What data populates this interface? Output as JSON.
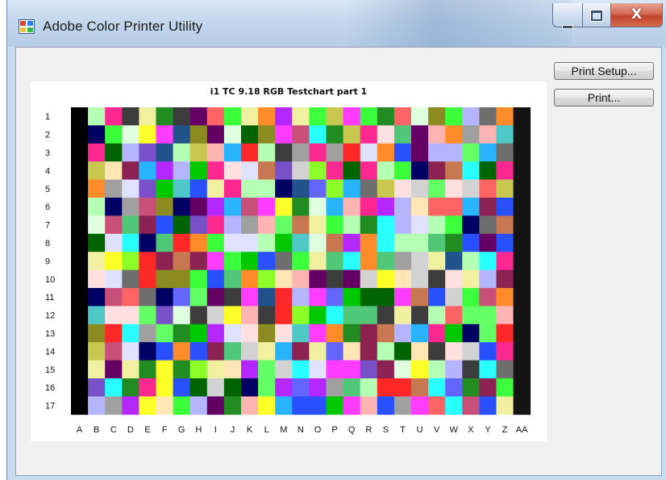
{
  "window": {
    "title": "Adobe Color Printer Utility",
    "controls": {
      "minimize": "minimize",
      "maximize": "maximize",
      "close": "X"
    }
  },
  "buttons": {
    "print_setup_label": "Print Setup...",
    "print_label": "Print..."
  },
  "chart_data": {
    "type": "heatmap",
    "title": "i1 TC 9.18 RGB Testchart part 1",
    "rows": [
      "1",
      "2",
      "3",
      "4",
      "5",
      "6",
      "7",
      "8",
      "9",
      "10",
      "11",
      "12",
      "13",
      "14",
      "15",
      "16",
      "17"
    ],
    "columns": [
      "A",
      "B",
      "C",
      "D",
      "E",
      "F",
      "G",
      "H",
      "I",
      "J",
      "K",
      "L",
      "M",
      "N",
      "O",
      "P",
      "Q",
      "R",
      "S",
      "T",
      "U",
      "V",
      "W",
      "X",
      "Y",
      "Z",
      "AA"
    ],
    "palette": [
      "#00c800",
      "#ff3cff",
      "#3cff3c",
      "#ff2828",
      "#2850ff",
      "#ffff28",
      "#28ffff",
      "#b428ff",
      "#ff8c28",
      "#28b4ff",
      "#8cff28",
      "#ff2890",
      "#50c878",
      "#c85078",
      "#7850c8",
      "#c8c850",
      "#50c8c8",
      "#c87850",
      "#a0a0a0",
      "#6e6e6e",
      "#d2d2d2",
      "#3c3c3c",
      "#ffb4b4",
      "#b4ffb4",
      "#b4b4ff",
      "#ffe6b4",
      "#228b22",
      "#8b2252",
      "#22528b",
      "#8b8b22",
      "#e0e0ff",
      "#ffe0e0",
      "#e0ffe0",
      "#006400",
      "#640064",
      "#000064",
      "#ff6464",
      "#64ff64",
      "#6464ff",
      "#f0f0a0"
    ],
    "first_column_color": "#000000",
    "last_column_color": "#141414"
  }
}
